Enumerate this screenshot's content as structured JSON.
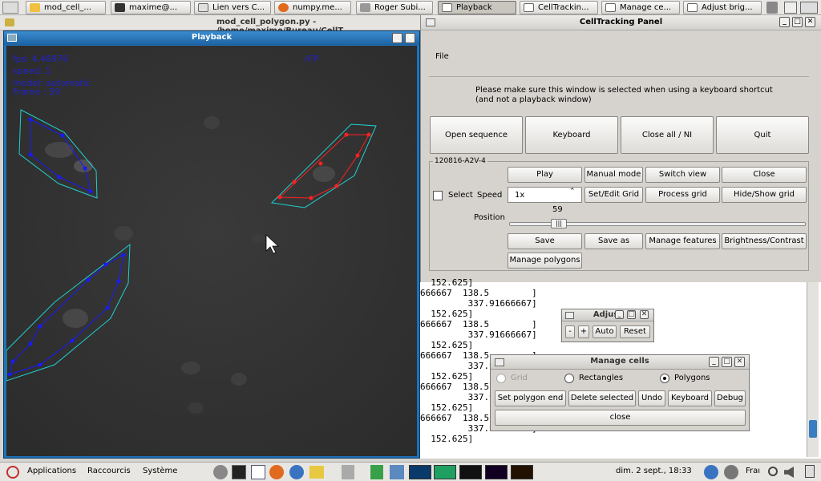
{
  "taskbar": {
    "items": [
      {
        "label": "mod_cell_..."
      },
      {
        "label": "maxime@..."
      },
      {
        "label": "Lien vers C..."
      },
      {
        "label": "numpy.me..."
      },
      {
        "label": "Roger Subi..."
      },
      {
        "label": "Playback"
      },
      {
        "label": "CellTrackin..."
      },
      {
        "label": "Manage ce..."
      },
      {
        "label": "Adjust brig..."
      }
    ]
  },
  "background_window": {
    "title": "mod_cell_polygon.py - /home/maxime/Bureau/CellT"
  },
  "playback": {
    "title": "Playback",
    "overlay": {
      "fps": "fps: 4.48976",
      "speed": "speed: 1",
      "mode": "model: automatic",
      "frame": "Frame : 59",
      "channel": "rFP"
    }
  },
  "panel": {
    "title": "CellTracking Panel",
    "menu_file": "File",
    "instructions": "Please make sure this window is selected when using a keyboard shortcut",
    "instructions2": "(and not a playback window)",
    "buttons": {
      "open": "Open sequence",
      "keyboard": "Keyboard",
      "close_all": "Close all / NI",
      "quit": "Quit"
    },
    "sequence": {
      "name": "120816-A2V-4",
      "play": "Play",
      "manual": "Manual mode",
      "switch": "Switch view",
      "close": "Close",
      "select_label": "Select",
      "speed_label": "Speed",
      "speed_value": "1x",
      "set_edit": "Set/Edit Grid",
      "process": "Process grid",
      "hide_show": "Hide/Show grid",
      "position_label": "Position",
      "position_value": "59",
      "save": "Save",
      "save_as": "Save as",
      "manage_features": "Manage features",
      "brightness": "Brightness/Contrast",
      "manage_polygons": "Manage polygons"
    }
  },
  "console": {
    "lines": [
      "  152.625]",
      "666667  138.5        ]",
      "         337.91666667]",
      "  152.625]",
      "666667  138.5        ]",
      "         337.91666667]",
      "  152.625]",
      "666667  138.5        ]",
      "         337.91666667]",
      "  152.625]",
      "666667  138.5        ]",
      "         337.91666667]",
      "  152.625]",
      "666667  138.5        ]",
      "         337.91666667]",
      "  152.625]"
    ]
  },
  "adjust": {
    "title": "Adjust",
    "minus": "-",
    "plus": "+",
    "auto": "Auto",
    "reset": "Reset"
  },
  "manage_cells": {
    "title": "Manage cells",
    "grid": "Grid",
    "rectangles": "Rectangles",
    "polygons": "Polygons",
    "set_polygon_end": "Set polygon end",
    "delete_selected": "Delete selected",
    "undo": "Undo",
    "keyboard": "Keyboard",
    "debug": "Debug",
    "close": "close"
  },
  "bottombar": {
    "applications": "Applications",
    "shortcuts": "Raccourcis",
    "system": "Système",
    "clock": "dim. 2 sept., 18:33",
    "lang": "Fraı"
  },
  "colors": {
    "accent": "#1f72b6",
    "polygon_blue": "#1a1aff",
    "polygon_red": "#ff2020",
    "outline_cyan": "#20d0d0"
  }
}
